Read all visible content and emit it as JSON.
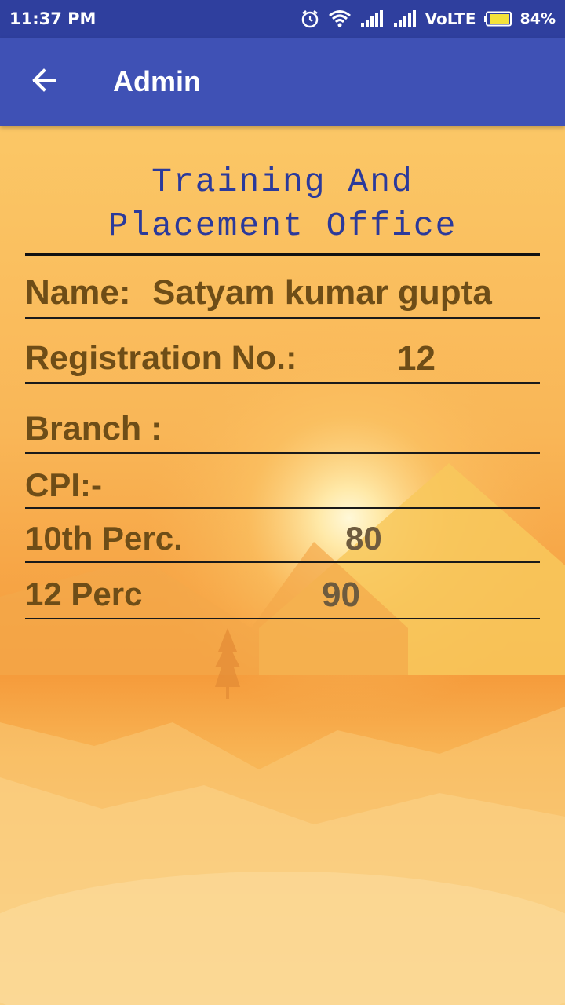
{
  "status_bar": {
    "time": "11:37 PM",
    "carrier": "VoLTE",
    "battery": "84%",
    "icons": [
      "alarm-icon",
      "wifi-icon",
      "signal-icon",
      "signal-icon",
      "battery-icon"
    ]
  },
  "app_bar": {
    "title": "Admin",
    "back_icon": "arrow-left-icon"
  },
  "office": {
    "title_line1": "Training And",
    "title_line2": "Placement Office"
  },
  "profile": {
    "name_label": "Name:",
    "name_value": "Satyam kumar gupta",
    "reg_label": "Registration No.:",
    "reg_value": "12",
    "branch_label": "Branch :",
    "branch_value": "",
    "cpi_label": "CPI:-",
    "cpi_value": "",
    "tenth_label": "10th Perc.",
    "tenth_value": "80",
    "twelfth_label": "12 Perc",
    "twelfth_value": "90"
  },
  "colors": {
    "status_bar": "#2f3f9e",
    "app_bar": "#3f51b5",
    "title_text": "#2b3a9b",
    "row_text": "#6e4d17"
  }
}
